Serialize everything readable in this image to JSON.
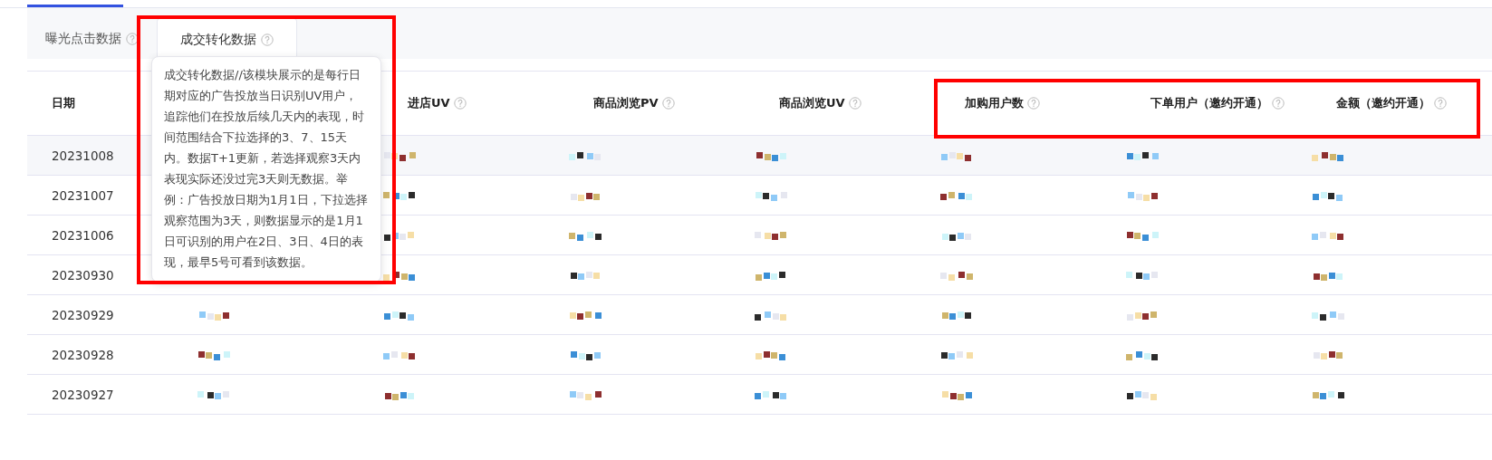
{
  "top_tabs": [
    {
      "selected": true
    }
  ],
  "tabs": [
    {
      "label": "曝光点击数据",
      "selected": false,
      "help": true
    },
    {
      "label": "成交转化数据",
      "selected": true,
      "help": true
    }
  ],
  "tooltip": {
    "text": "成交转化数据//该模块展示的是每行日期对应的广告投放当日识别UV用户，追踪他们在投放后续几天内的表现，时间范围结合下拉选择的3、7、15天内。数据T+1更新，若选择观察3天内表现实际还没过完3天则无数据。举例：广告投放日期为1月1日，下拉选择观察范围为3天，则数据显示的是1月1日可识别的用户在2日、3日、4日的表现，最早5号可看到该数据。"
  },
  "table": {
    "columns": [
      {
        "label": "日期",
        "help": false
      },
      {
        "label": "进店UV",
        "help": true
      },
      {
        "label": "商品浏览PV",
        "help": true
      },
      {
        "label": "商品浏览UV",
        "help": true
      },
      {
        "label": "加购用户数",
        "help": true
      },
      {
        "label": "下单用户（邀约开通）",
        "help": true
      },
      {
        "label": "金额（邀约开通）",
        "help": true
      }
    ],
    "rows": [
      {
        "date": "20231008",
        "hovered": true
      },
      {
        "date": "20231007",
        "hovered": false
      },
      {
        "date": "20231006",
        "hovered": false
      },
      {
        "date": "20230930",
        "hovered": false
      },
      {
        "date": "20230929",
        "hovered": false
      },
      {
        "date": "20230928",
        "hovered": false
      },
      {
        "date": "20230927",
        "hovered": false
      }
    ]
  },
  "annotations": [
    {
      "kind": "frame",
      "color": "#ff0000"
    },
    {
      "kind": "frame",
      "color": "#ff0000"
    }
  ]
}
